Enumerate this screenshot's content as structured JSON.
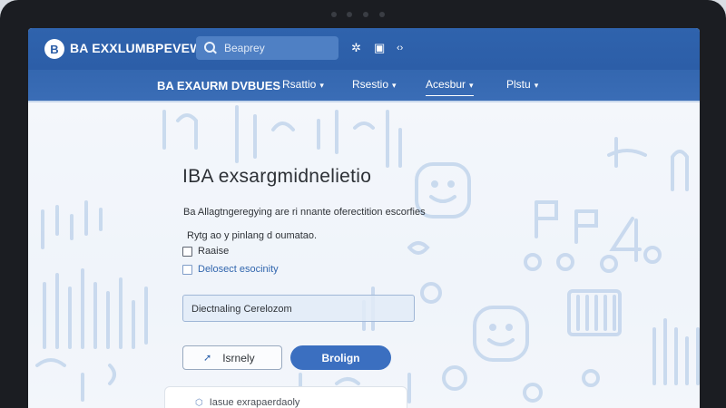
{
  "app": {
    "logo_letter": "B",
    "brand": "BA EXXLUMBPEVEW"
  },
  "search": {
    "placeholder": "Beaprey"
  },
  "header_icons": [
    "gear-icon",
    "clipboard-icon",
    "code-icon"
  ],
  "nav": {
    "title": "BA EXAURM DVBUES",
    "items": [
      {
        "label": "Rsattio",
        "active": false
      },
      {
        "label": "Rsestio",
        "active": false
      },
      {
        "label": "Acesbur",
        "active": true
      },
      {
        "label": "Plstu",
        "active": false
      }
    ]
  },
  "main": {
    "title": "IBA exsargmidnelietio",
    "subtitle": "Ba Allagtngeregying are ri nnante oferectition escorfies",
    "question": "Rytg ao y pinlang d oumatao.",
    "options": [
      {
        "label": "Raaise",
        "checked": false
      },
      {
        "label": "Delosect esocinity",
        "checked": false
      }
    ],
    "field_value": "Diectnaling Cerelozom",
    "secondary_button": "Isrnely",
    "primary_button": "Brolign",
    "card_text": "Iasue exrapaerdaoly"
  },
  "colors": {
    "header": "#2f63ad",
    "accent": "#3b6fc0"
  }
}
